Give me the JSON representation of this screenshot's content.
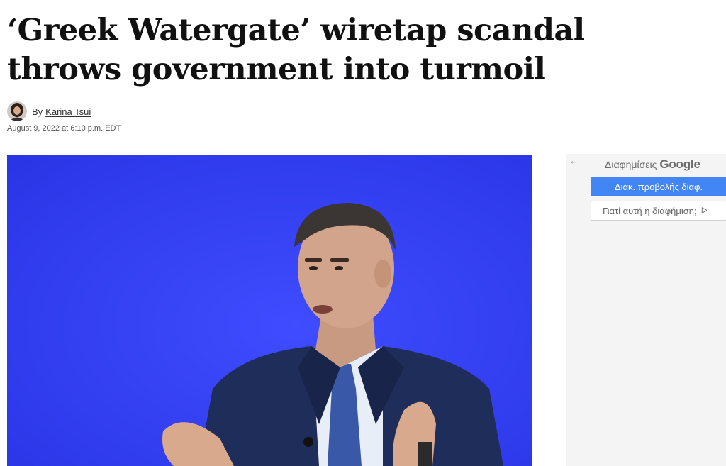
{
  "article": {
    "headline": "‘Greek Watergate’ wiretap scandal throws government into turmoil",
    "byline_prefix": "By",
    "author": "Karina Tsui",
    "timestamp": "August 9, 2022 at 6:10 p.m. EDT"
  },
  "hero_image": {
    "background_color": "#2f3df0"
  },
  "ad_panel": {
    "back_icon": "←",
    "header_label": "Διαφημίσεις",
    "header_brand": "Google",
    "stop_button_label": "Διακ. προβολής διαφ.",
    "why_button_label": "Γιατί αυτή η διαφήμιση;",
    "why_icon": "ᐅ",
    "accent_color": "#4285f4"
  }
}
